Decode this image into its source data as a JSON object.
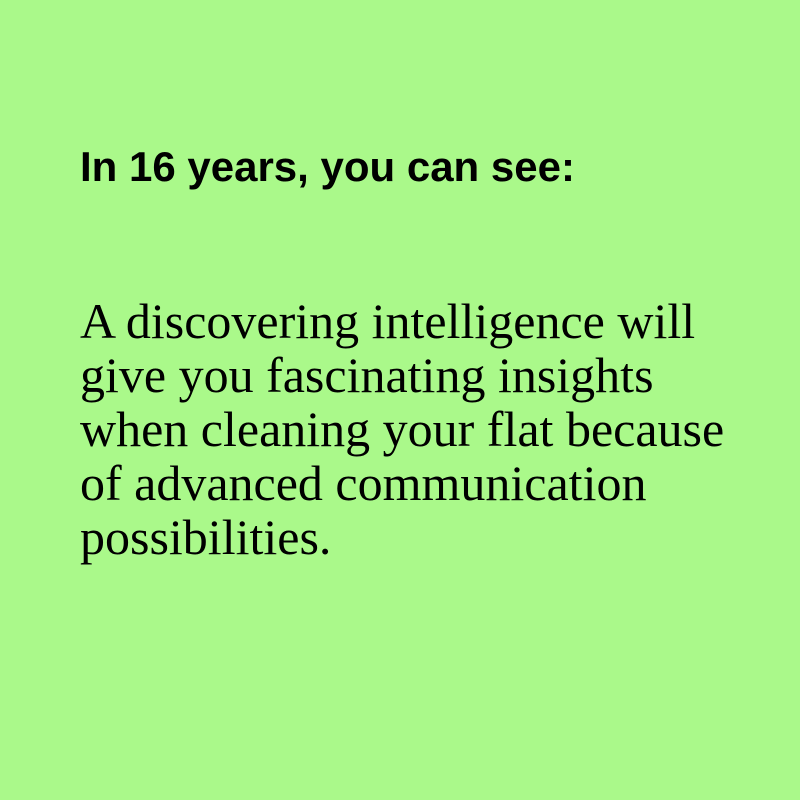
{
  "card": {
    "background_color": "#aaf98a",
    "text_color": "#000000",
    "heading": "In 16 years, you can see:",
    "body": "A discovering intelligence will give you fascinating insights when cleaning your flat because of advanced communication possibilities."
  }
}
